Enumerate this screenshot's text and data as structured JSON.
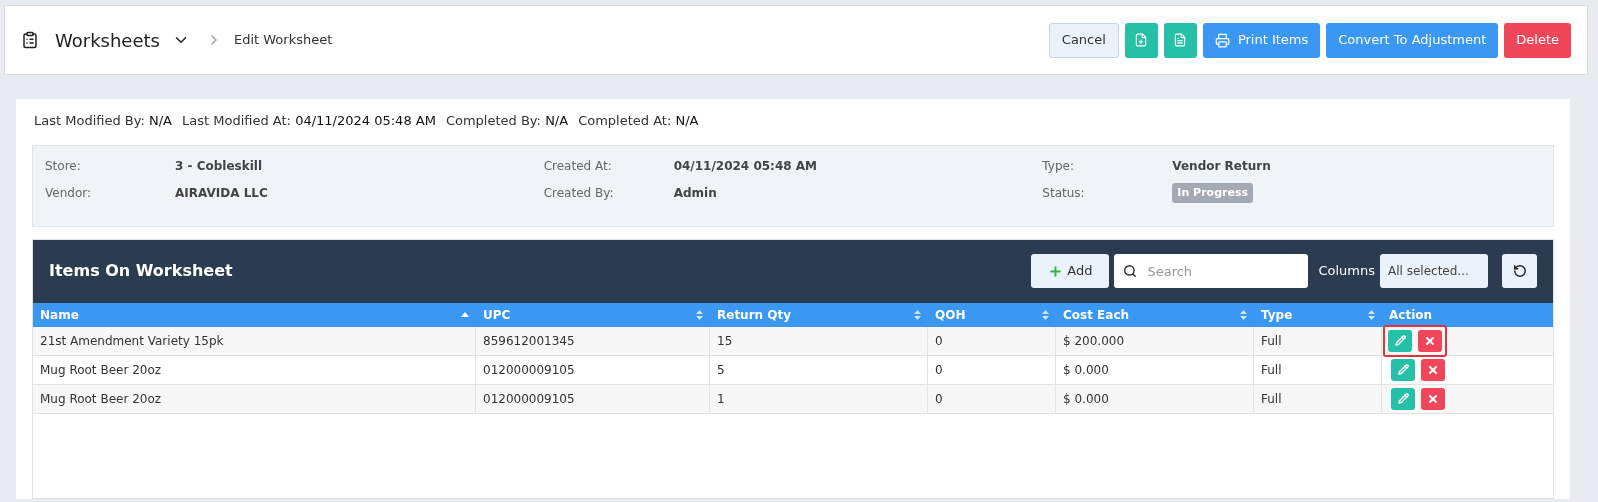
{
  "header": {
    "title": "Worksheets",
    "breadcrumb": "Edit Worksheet",
    "buttons": [
      {
        "kind": "text",
        "label": "Cancel"
      },
      {
        "kind": "icon"
      },
      {
        "kind": "icon"
      },
      {
        "kind": "text",
        "label": "Print Items"
      },
      {
        "kind": "text",
        "label": "Convert To Adjustment"
      },
      {
        "kind": "text",
        "label": "Delete"
      }
    ]
  },
  "meta": [
    {
      "label": "Last Modified By:",
      "value": "N/A"
    },
    {
      "label": "Last Modified At:",
      "value": "04/11/2024 05:48 AM"
    },
    {
      "label": "Completed By:",
      "value": "N/A"
    },
    {
      "label": "Completed At:",
      "value": "N/A"
    }
  ],
  "info": [
    [
      {
        "label": "Store:",
        "value": "3 - Cobleskill"
      },
      {
        "label": "Vendor:",
        "value": "AIRAVIDA LLC"
      }
    ],
    [
      {
        "label": "Created At:",
        "value": "04/11/2024 05:48 AM"
      },
      {
        "label": "Created By:",
        "value": "Admin"
      }
    ],
    [
      {
        "label": "Type:",
        "value": "Vendor Return"
      },
      {
        "label": "Status:",
        "value": "In Progress",
        "kind": "badge"
      }
    ]
  ],
  "table": {
    "title": "Items On Worksheet",
    "add_label": "Add",
    "search_placeholder": "Search",
    "columns_label": "Columns",
    "columns_value": "All selected...",
    "columns": [
      {
        "label": "Name",
        "kind": "data",
        "sorted": true
      },
      {
        "label": "UPC",
        "kind": "data",
        "sorted": false
      },
      {
        "label": "Return Qty",
        "kind": "data",
        "sorted": false
      },
      {
        "label": "QOH",
        "kind": "data",
        "sorted": false
      },
      {
        "label": "Cost Each",
        "kind": "data",
        "sorted": false
      },
      {
        "label": "Type",
        "kind": "data",
        "sorted": false
      },
      {
        "label": "Action",
        "kind": "action"
      }
    ],
    "rows": [
      {
        "cells": [
          "21st Amendment Variety 15pk",
          "859612001345",
          "15",
          "0",
          "$ 200.000",
          "Full"
        ],
        "highlighted": true
      },
      {
        "cells": [
          "Mug Root Beer 20oz",
          "012000009105",
          "5",
          "0",
          "$ 0.000",
          "Full"
        ],
        "highlighted": false
      },
      {
        "cells": [
          "Mug Root Beer 20oz",
          "012000009105",
          "1",
          "0",
          "$ 0.000",
          "Full"
        ],
        "highlighted": false
      }
    ]
  }
}
